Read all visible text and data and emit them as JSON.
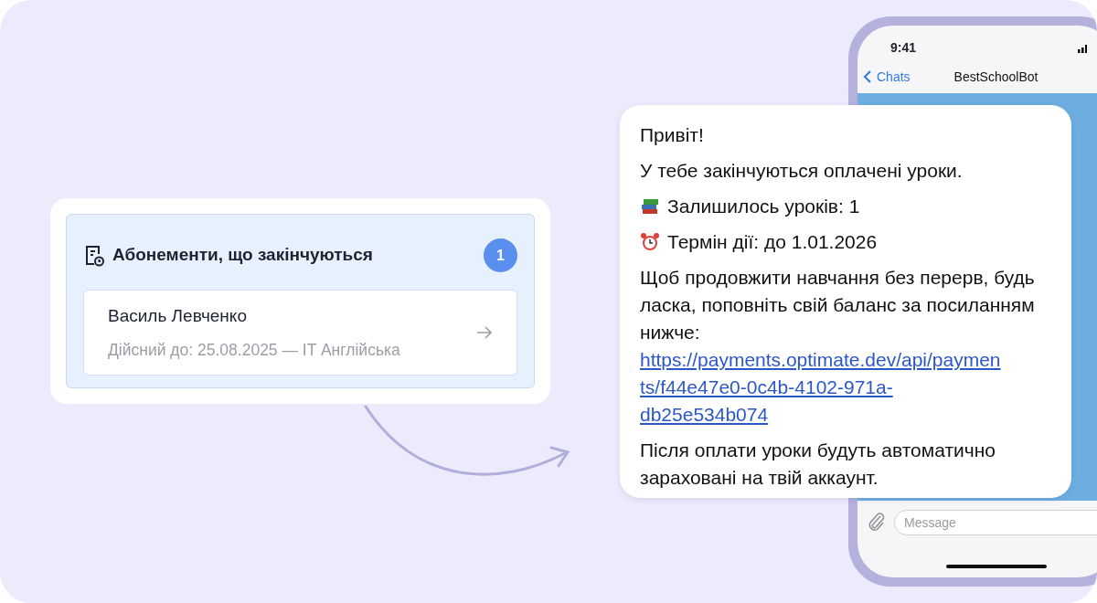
{
  "widget": {
    "title": "Абонементи, що закінчуються",
    "count": "1",
    "items": [
      {
        "name": "Василь Левченко",
        "detail": "Дійсний до: 25.08.2025 — IT Англійська"
      }
    ]
  },
  "phone": {
    "time": "9:41",
    "back": "Chats",
    "chat_title": "BestSchoolBot",
    "input": {
      "placeholder": "Message"
    }
  },
  "message": {
    "lines": [
      {
        "kind": "text",
        "text": "Привіт!"
      },
      {
        "kind": "text",
        "text": "У тебе закінчуються оплачені уроки."
      },
      {
        "kind": "books",
        "text": "Залишилось уроків: 1"
      },
      {
        "kind": "alarm",
        "text": "Термін дії: до 1.01.2026"
      },
      {
        "kind": "text",
        "text": "Щоб продовжити навчання без перерв, будь ласка, поповніть свій баланс за посиланням нижче:",
        "link": "https://payments.optimate.dev/api/payments/f44e47e0-0c4b-4102-971a-db25e534b074"
      },
      {
        "kind": "text",
        "text": "Після оплати уроки будуть автоматично зараховані на твій аккаунт."
      }
    ]
  }
}
